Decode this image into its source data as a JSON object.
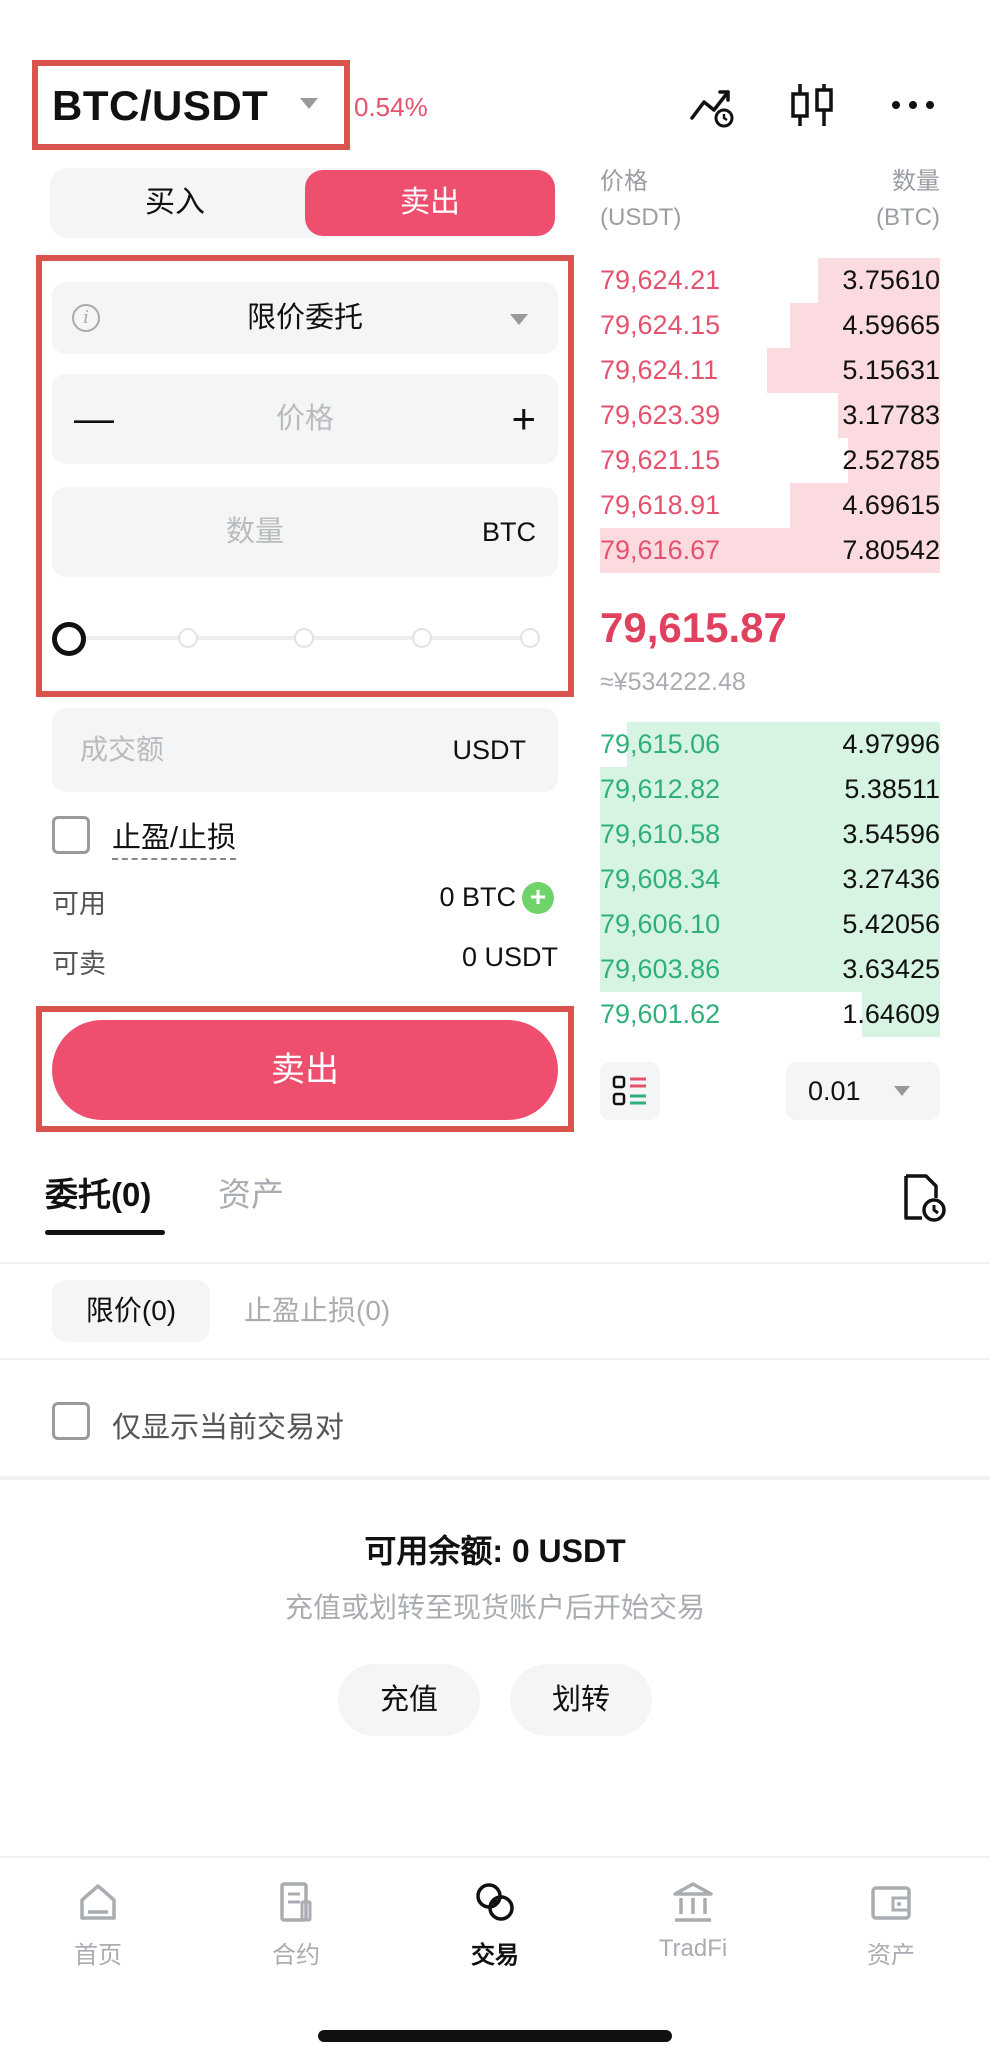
{
  "header": {
    "pair": "BTC/USDT",
    "change": "0.54%",
    "icons": [
      "price-alert-icon",
      "candlestick-chart-icon",
      "more-icon"
    ]
  },
  "side_tabs": {
    "buy": "买入",
    "sell": "卖出",
    "active": "sell"
  },
  "form": {
    "order_type": "限价委托",
    "price_placeholder": "价格",
    "minus": "—",
    "plus": "+",
    "qty_placeholder": "数量",
    "qty_unit": "BTC",
    "slider_percent": 0,
    "total_placeholder": "成交额",
    "total_unit": "USDT",
    "tpsl_label": "止盈/止损",
    "available_label": "可用",
    "available_value": "0 BTC",
    "sellable_label": "可卖",
    "sellable_value": "0 USDT",
    "submit_label": "卖出"
  },
  "orderbook": {
    "price_header": "价格",
    "price_unit": "(USDT)",
    "qty_header": "数量",
    "qty_unit": "(BTC)",
    "asks": [
      {
        "price": "79,624.21",
        "qty": "3.75610",
        "depth": 0.36
      },
      {
        "price": "79,624.15",
        "qty": "4.59665",
        "depth": 0.44
      },
      {
        "price": "79,624.11",
        "qty": "5.15631",
        "depth": 0.51
      },
      {
        "price": "79,623.39",
        "qty": "3.17783",
        "depth": 0.3
      },
      {
        "price": "79,621.15",
        "qty": "2.52785",
        "depth": 0.27
      },
      {
        "price": "79,618.91",
        "qty": "4.69615",
        "depth": 0.44
      },
      {
        "price": "79,616.67",
        "qty": "7.80542",
        "depth": 1.0
      }
    ],
    "last_price": "79,615.87",
    "fiat_price": "≈¥534222.48",
    "bids": [
      {
        "price": "79,615.06",
        "qty": "4.97996",
        "depth": 0.92
      },
      {
        "price": "79,612.82",
        "qty": "5.38511",
        "depth": 1.0
      },
      {
        "price": "79,610.58",
        "qty": "3.54596",
        "depth": 1.0
      },
      {
        "price": "79,608.34",
        "qty": "3.27436",
        "depth": 1.0
      },
      {
        "price": "79,606.10",
        "qty": "5.42056",
        "depth": 1.0
      },
      {
        "price": "79,603.86",
        "qty": "3.63425",
        "depth": 1.0
      },
      {
        "price": "79,601.62",
        "qty": "1.64609",
        "depth": 0.23
      }
    ],
    "step": "0.01"
  },
  "orders": {
    "tab_orders": "委托(0)",
    "tab_assets": "资产",
    "sub_limit": "限价(0)",
    "sub_tpsl": "止盈止损(0)",
    "only_current": "仅显示当前交易对",
    "empty_title": "可用余额: 0 USDT",
    "empty_sub": "充值或划转至现货账户后开始交易",
    "deposit": "充值",
    "transfer": "划转"
  },
  "nav": [
    {
      "label": "首页",
      "icon": "home-icon"
    },
    {
      "label": "合约",
      "icon": "contract-icon"
    },
    {
      "label": "交易",
      "icon": "trade-icon",
      "active": true
    },
    {
      "label": "TradFi",
      "icon": "bank-icon"
    },
    {
      "label": "资产",
      "icon": "wallet-icon"
    }
  ],
  "colors": {
    "accent_red": "#ee4f6e",
    "ask_text": "#e5526e",
    "bid_text": "#2fb07a",
    "highlight_box": "#d9534f"
  }
}
